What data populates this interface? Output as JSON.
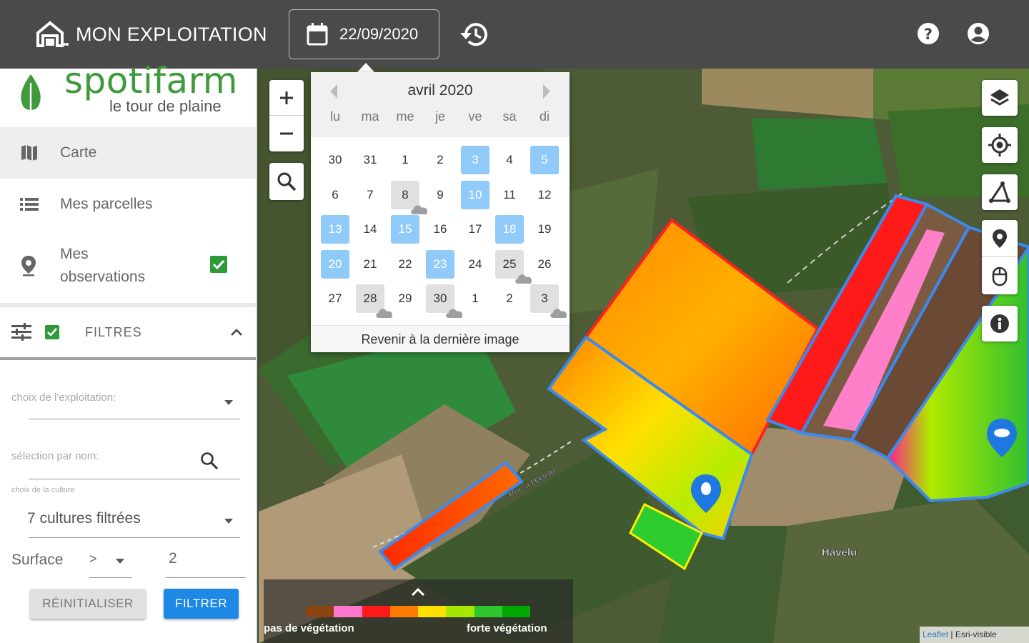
{
  "header": {
    "farm_label": "MON EXPLOITATION",
    "date": "22/09/2020"
  },
  "logo": {
    "name": "spotifarm",
    "tagline": "le tour de plaine"
  },
  "nav": {
    "carte": "Carte",
    "parcelles": "Mes parcelles",
    "observations": "Mes observations"
  },
  "filters": {
    "title": "FILTRES",
    "exploitation_label": "choix de l'exploitation:",
    "name_label": "sélection par nom:",
    "culture_label": "choix de la culture",
    "culture_value": "7 cultures filtrées",
    "surface_label": "Surface",
    "surface_op": ">",
    "surface_value": "2",
    "reset": "RÉINITIALISER",
    "apply": "FILTRER"
  },
  "calendar": {
    "month": "avril 2020",
    "dow": [
      "lu",
      "ma",
      "me",
      "je",
      "ve",
      "sa",
      "di"
    ],
    "weeks": [
      [
        "30",
        "31",
        "1",
        "2",
        "3",
        "4",
        "5"
      ],
      [
        "6",
        "7",
        "8",
        "9",
        "10",
        "11",
        "12"
      ],
      [
        "13",
        "14",
        "15",
        "16",
        "17",
        "18",
        "19"
      ],
      [
        "20",
        "21",
        "22",
        "23",
        "24",
        "25",
        "26"
      ],
      [
        "27",
        "28",
        "29",
        "30",
        "1",
        "2",
        "3"
      ]
    ],
    "selected": [
      "0-4",
      "0-6",
      "1-4",
      "2-0",
      "2-2",
      "2-5",
      "3-0",
      "3-3"
    ],
    "cloudy": [
      "1-2",
      "3-5",
      "4-1",
      "4-3",
      "4-6"
    ],
    "footer": "Revenir à la dernière image"
  },
  "map": {
    "place_label": "Havelu",
    "road_label": "Rue à Havelu",
    "legend": {
      "low": "pas de végétation",
      "high": "forte végétation",
      "colors": [
        "#8b4513",
        "#ff77cc",
        "#ff1a1a",
        "#ff7a00",
        "#ffe000",
        "#a6e600",
        "#2fc52f",
        "#00a800"
      ]
    },
    "attribution_link": "Leaflet",
    "attribution_rest": " | Esri-visible"
  }
}
